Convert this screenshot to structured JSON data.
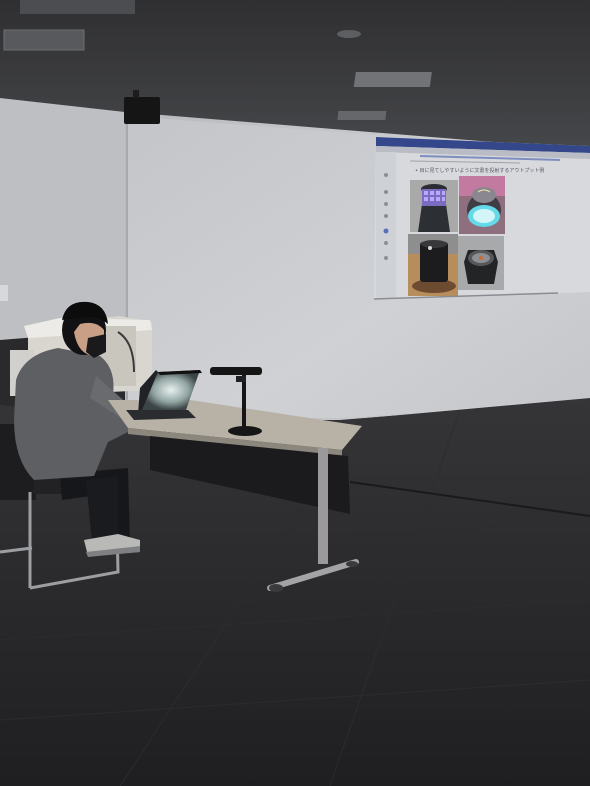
{
  "projection": {
    "heading": "• 目に見てしやすいように文書を投射するアウトプット例",
    "thumbnails": [
      {
        "kind": "purple-led-cube"
      },
      {
        "kind": "cyan-led-ring"
      },
      {
        "kind": "black-speaker"
      },
      {
        "kind": "hex-speaker"
      }
    ]
  },
  "colors": {
    "ceiling": "#3b3b3e",
    "wall": "#c7c8cb",
    "screen": "#c9cbcf",
    "floor": "#262628",
    "table_top": "#b9b4aa",
    "sweater": "#5b5c5f"
  }
}
